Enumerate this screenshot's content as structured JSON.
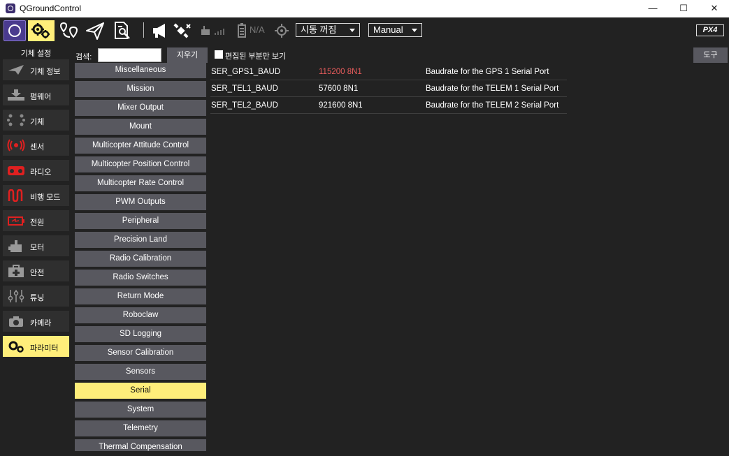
{
  "window": {
    "title": "QGroundControl",
    "minimize": "—",
    "maximize": "☐",
    "close": "✕"
  },
  "toolbar": {
    "battery": "N/A",
    "flight_status": "시동 꺼짐",
    "flight_mode": "Manual",
    "brand": "PX4"
  },
  "sidebar": {
    "header": "기체 설정",
    "items": [
      {
        "label": "기체 정보",
        "icon": "plane-icon"
      },
      {
        "label": "펌웨어",
        "icon": "download-icon"
      },
      {
        "label": "기체",
        "icon": "airframe-icon"
      },
      {
        "label": "센서",
        "icon": "sensor-icon"
      },
      {
        "label": "라디오",
        "icon": "radio-icon"
      },
      {
        "label": "비행 모드",
        "icon": "flight-mode-icon"
      },
      {
        "label": "전원",
        "icon": "battery-icon"
      },
      {
        "label": "모터",
        "icon": "motor-icon"
      },
      {
        "label": "안전",
        "icon": "safety-icon"
      },
      {
        "label": "튜닝",
        "icon": "tuning-icon"
      },
      {
        "label": "카메라",
        "icon": "camera-icon"
      },
      {
        "label": "파라미터",
        "icon": "gears-icon"
      }
    ]
  },
  "search": {
    "label": "검색:",
    "value": "",
    "clear_label": "지우기"
  },
  "modified_only": {
    "label": "편집된 부분만 보기",
    "checked": false
  },
  "tools_label": "도구",
  "groups": [
    "Miscellaneous",
    "Mission",
    "Mixer Output",
    "Mount",
    "Multicopter Attitude Control",
    "Multicopter Position Control",
    "Multicopter Rate Control",
    "PWM Outputs",
    "Peripheral",
    "Precision Land",
    "Radio Calibration",
    "Radio Switches",
    "Return Mode",
    "Roboclaw",
    "SD Logging",
    "Sensor Calibration",
    "Sensors",
    "Serial",
    "System",
    "Telemetry",
    "Thermal Compensation"
  ],
  "selected_group": "Serial",
  "params": [
    {
      "name": "SER_GPS1_BAUD",
      "value": "115200 8N1",
      "description": "Baudrate for the GPS 1 Serial Port",
      "modified": true
    },
    {
      "name": "SER_TEL1_BAUD",
      "value": "57600 8N1",
      "description": "Baudrate for the TELEM 1 Serial Port",
      "modified": false
    },
    {
      "name": "SER_TEL2_BAUD",
      "value": "921600 8N1",
      "description": "Baudrate for the TELEM 2 Serial Port",
      "modified": false
    }
  ],
  "colors": {
    "accent": "#ffee7a",
    "modified_value": "#e85c5c",
    "button_bg": "#58585f",
    "background": "#222222"
  }
}
